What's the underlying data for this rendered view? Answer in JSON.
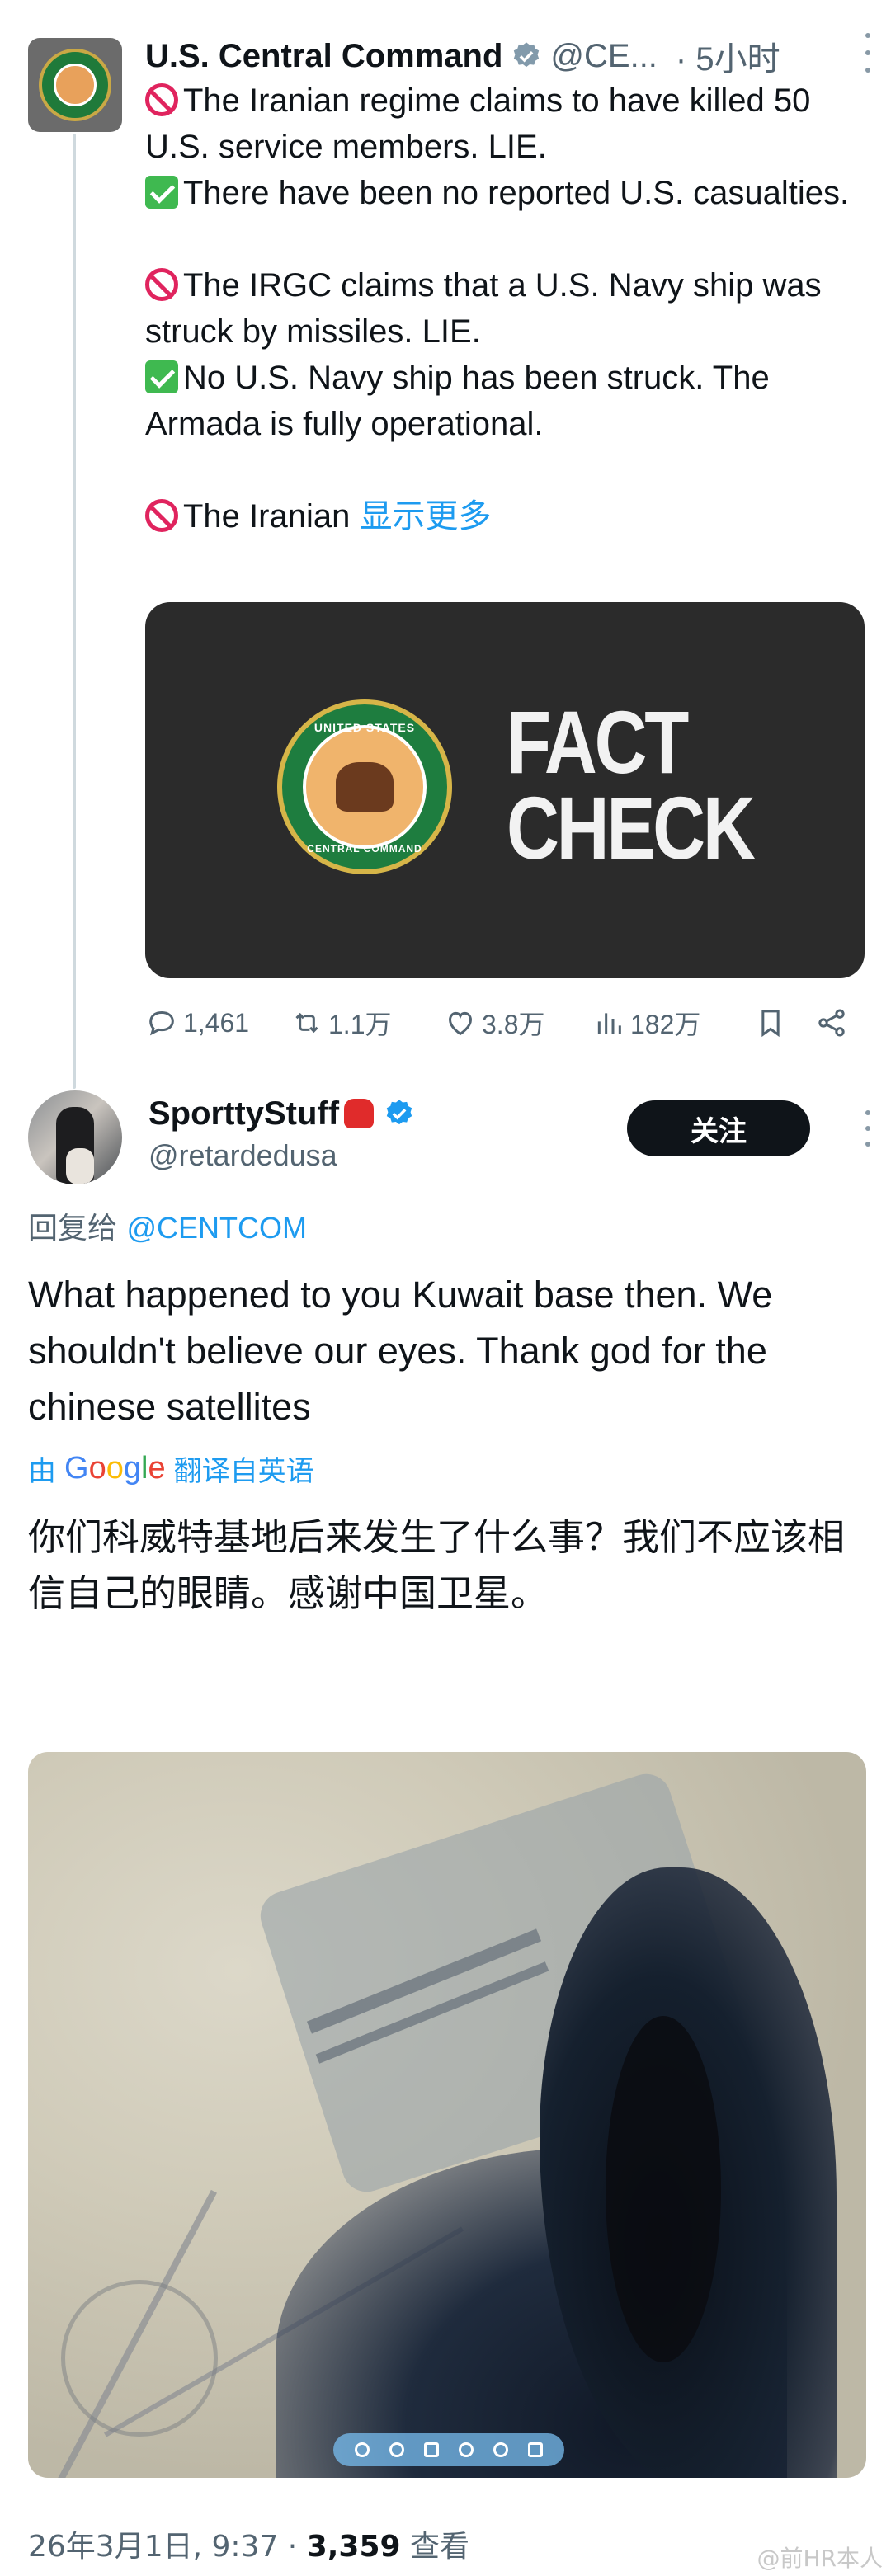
{
  "tweet": {
    "author_name": "U.S. Central Command",
    "handle": "@CE...",
    "time": "· 5小时",
    "lines": [
      "The Iranian regime claims to have killed 50 U.S. service members. LIE.",
      "There have been no reported U.S. casualties.",
      "The IRGC claims that a U.S. Navy ship was struck by missiles. LIE.",
      "No U.S. Navy ship has been struck. The Armada is fully operational.",
      "The Iranian"
    ],
    "show_more": "显示更多",
    "card": {
      "seal_caption_top": "UNITED STATES",
      "seal_caption_bottom": "CENTRAL COMMAND",
      "title_line1": "FACT",
      "title_line2": "CHECK"
    },
    "stats": {
      "replies": "1,461",
      "retweets": "1.1万",
      "likes": "3.8万",
      "views": "182万"
    }
  },
  "reply": {
    "author_name": "SporttyStuff",
    "handle": "@retardedusa",
    "follow_label": "关注",
    "reply_to_label": "回复给",
    "reply_to_mention": "@CENTCOM",
    "text": "What happened to you Kuwait base then. We shouldn't believe our eyes. Thank god for the chinese satellites",
    "translated_prefix": "由",
    "translated_suffix": "翻译自英语",
    "translation": "你们科威特基地后来发生了什么事？我们不应该相信自己的眼睛。感谢中国卫星。",
    "meta_date": "26年3月1日, 9:37 · ",
    "meta_views": "3,359",
    "meta_views_label": " 查看"
  },
  "watermark": "@前HR本人",
  "icons": {
    "verified_gray": "verified-badge-gray-icon",
    "verified_blue": "verified-badge-blue-icon",
    "reply": "comment-icon",
    "retweet": "retweet-icon",
    "like": "heart-icon",
    "views": "bar-chart-icon",
    "bookmark": "bookmark-icon",
    "share": "share-icon"
  },
  "colors": {
    "link": "#1d9bf0",
    "secondary_text": "#536471",
    "follow_button": "#0f1419"
  }
}
